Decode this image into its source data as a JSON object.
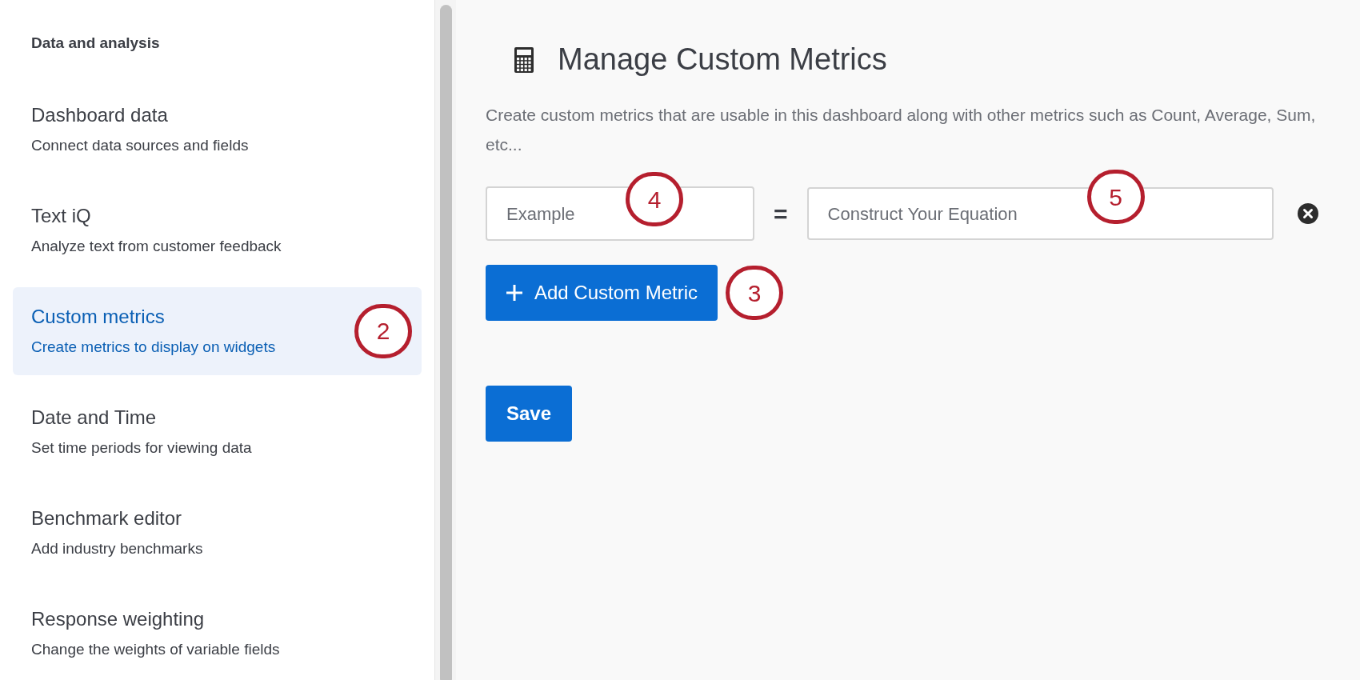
{
  "sidebar": {
    "heading": "Data and analysis",
    "items": [
      {
        "title": "Dashboard data",
        "subtitle": "Connect data sources and fields",
        "selected": false
      },
      {
        "title": "Text iQ",
        "subtitle": "Analyze text from customer feedback",
        "selected": false
      },
      {
        "title": "Custom metrics",
        "subtitle": "Create metrics to display on widgets",
        "selected": true,
        "callout": "2"
      },
      {
        "title": "Date and Time",
        "subtitle": "Set time periods for viewing data",
        "selected": false
      },
      {
        "title": "Benchmark editor",
        "subtitle": "Add industry benchmarks",
        "selected": false
      },
      {
        "title": "Response weighting",
        "subtitle": "Change the weights of variable fields",
        "selected": false
      }
    ]
  },
  "main": {
    "title": "Manage Custom Metrics",
    "description": "Create custom metrics that are usable in this dashboard along with other metrics such as Count, Average, Sum, etc...",
    "metric_row": {
      "name_placeholder": "Example",
      "name_callout": "4",
      "equals": "=",
      "equation_placeholder": "Construct Your Equation",
      "equation_callout": "5"
    },
    "add_button": {
      "label": "Add Custom Metric",
      "callout": "3"
    },
    "save_button": "Save"
  }
}
